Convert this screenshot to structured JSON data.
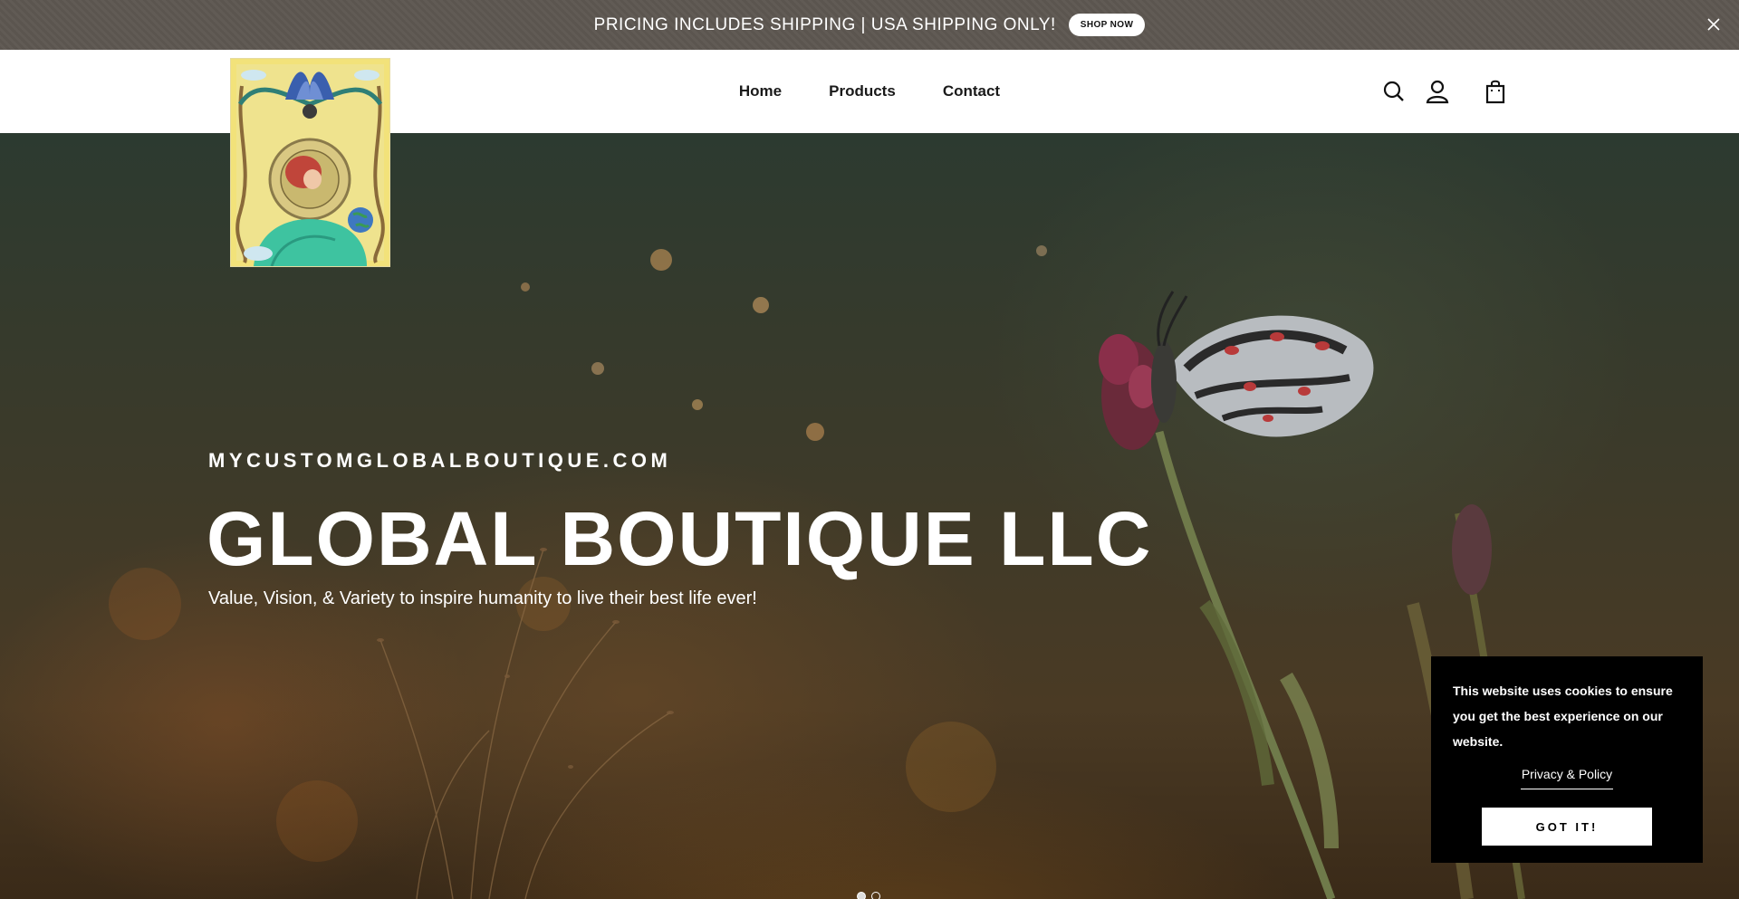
{
  "announcement": {
    "message": "PRICING INCLUDES SHIPPING | USA SHIPPING ONLY!",
    "cta_label": "SHOP NOW"
  },
  "nav": {
    "items": [
      {
        "label": "Home"
      },
      {
        "label": "Products"
      },
      {
        "label": "Contact"
      }
    ]
  },
  "header_icons": [
    "search-icon",
    "account-icon",
    "cart-icon"
  ],
  "hero": {
    "subtitle": "MYCUSTOMGLOBALBOUTIQUE.COM",
    "title": "GLOBAL BOUTIQUE LLC",
    "tagline": "Value, Vision, & Variety to inspire humanity to live their best life ever!",
    "slides": 2,
    "active_slide": 1
  },
  "cookie": {
    "text": "This website uses cookies to ensure you get the best experience on our website.",
    "policy_link": "Privacy & Policy",
    "accept_label": "GOT IT!"
  },
  "colors": {
    "announcement_bg": "#5e5852",
    "header_bg": "#ffffff",
    "cookie_bg": "#000000",
    "text_light": "#ffffff"
  }
}
